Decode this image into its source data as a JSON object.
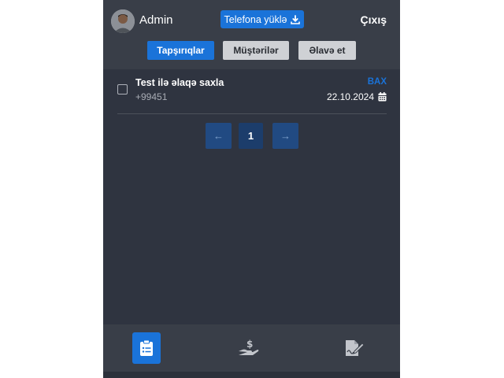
{
  "header": {
    "user_name": "Admin",
    "download_label": "Telefona yüklə",
    "logout_label": "Çıxış"
  },
  "tabs": [
    {
      "label": "Tapşırıqlar",
      "active": true
    },
    {
      "label": "Müştərilər",
      "active": false
    },
    {
      "label": "Əlavə et",
      "active": false
    }
  ],
  "tasks": [
    {
      "title": "Test ilə əlaqə saxla",
      "phone": "+99451",
      "action": "BAX",
      "date": "22.10.2024"
    }
  ],
  "pagination": {
    "prev": "←",
    "current": "1",
    "next": "→"
  },
  "bottom_nav": [
    {
      "icon": "clipboard-list-icon",
      "active": true
    },
    {
      "icon": "hand-dollar-icon",
      "active": false
    },
    {
      "icon": "document-signature-icon",
      "active": false
    }
  ],
  "colors": {
    "accent": "#1a73d9",
    "background": "#2f3440",
    "bar": "#393e48"
  }
}
